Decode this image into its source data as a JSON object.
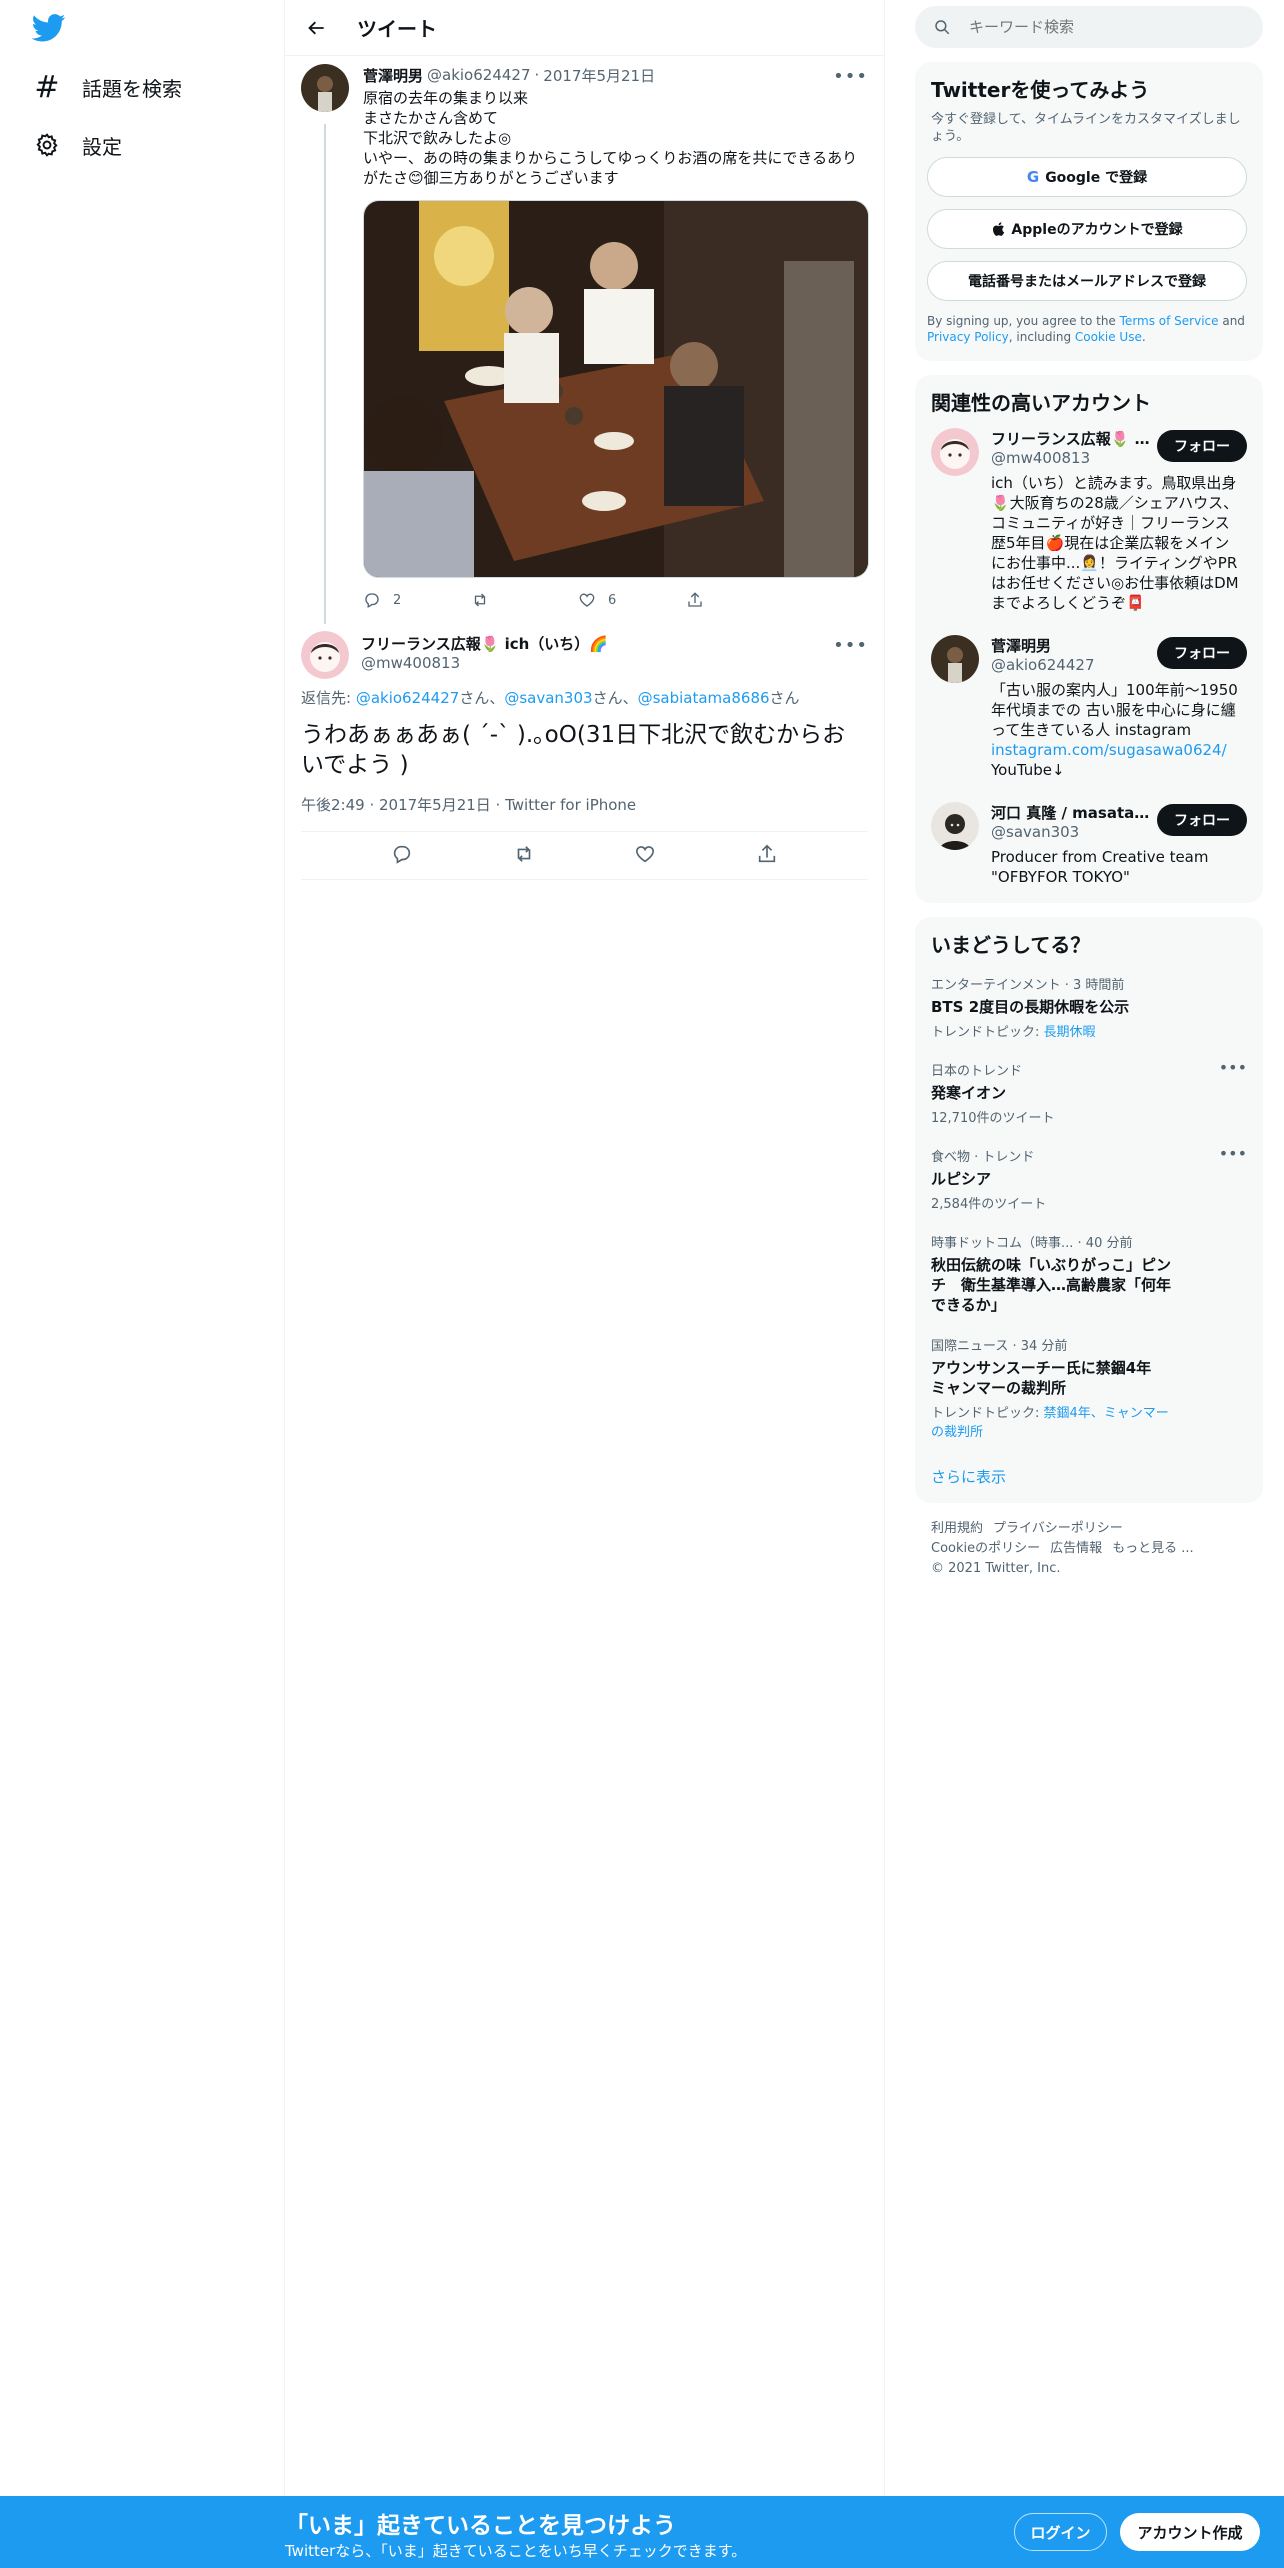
{
  "nav": {
    "explore_label": "話題を検索",
    "settings_label": "設定"
  },
  "header": {
    "title": "ツイート"
  },
  "tweet1": {
    "name": "菅澤明男",
    "handle": "@akio624427",
    "sep": "·",
    "date": "2017年5月21日",
    "text": "原宿の去年の集まり以来\nまさたかさん含めて\n下北沢で飲みしたよ◎\nいやー、あの時の集まりからこうしてゆっくりお酒の席を共にできるありがたさ😊御三方ありがとうございます",
    "reply_count": "2",
    "retweet_count": "",
    "like_count": "6"
  },
  "tweet2": {
    "name": "フリーランス広報🌷 ich（いち）🌈",
    "handle": "@mw400813",
    "reply_prefix": "返信先: ",
    "reply_users": [
      "@akio624427",
      "@savan303",
      "@sabiatama8686"
    ],
    "san": "さん",
    "comma": "、",
    "text": "うわあぁぁあぁ( ´-` ).｡oO(31日下北沢で飲むからおいでよう )",
    "timestamp": "午後2:49 · 2017年5月21日 · Twitter for iPhone"
  },
  "search": {
    "placeholder": "キーワード検索"
  },
  "signup": {
    "title": "Twitterを使ってみよう",
    "subtitle": "今すぐ登録して、タイムラインをカスタマイズしましょう。",
    "google_label": "Google で登録",
    "apple_label": "Appleのアカウントで登録",
    "phone_label": "電話番号またはメールアドレスで登録",
    "legal_prefix": "By signing up, you agree to the ",
    "terms": "Terms of Service",
    "and": " and ",
    "privacy": "Privacy Policy",
    "including": ", including ",
    "cookie": "Cookie Use",
    "period": "."
  },
  "who": {
    "title": "関連性の高いアカウント",
    "follow_label": "フォロー",
    "accounts": [
      {
        "name": "フリーランス広報🌷 ich（いち）🌈",
        "handle": "@mw400813",
        "bio": "ich（いち）と読みます。鳥取県出身🌷大阪育ちの28歳／シェアハウス、コミュニティが好き｜フリーランス歴5年目🍎現在は企業広報をメインにお仕事中...👩‍💼！ライティングやPRはお任せください◎お仕事依頼はDMまでよろしくどうぞ📮"
      },
      {
        "name": "菅澤明男",
        "handle": "@akio624427",
        "bio": "「古い服の案内人」100年前～1950年代頃までの 古い服を中心に身に纏って生きている人 instagram",
        "link": "instagram.com/sugasawa0624/",
        "bio2": "YouTube↓"
      },
      {
        "name": "河口 真隆 / masatak...",
        "handle": "@savan303",
        "bio": "Producer from Creative team \"OFBYFOR TOKYO\""
      }
    ]
  },
  "trends": {
    "title": "いまどうしてる？",
    "items": [
      {
        "cat": "エンターテインメント · 3 時間前",
        "title": "BTS 2度目の長期休暇を公示",
        "sub_prefix": "トレンドトピック: ",
        "sub_link": "長期休暇"
      },
      {
        "cat": "日本のトレンド",
        "title": "発寒イオン",
        "sub": "12,710件のツイート"
      },
      {
        "cat": "食べ物 · トレンド",
        "title": "ルピシア",
        "sub": "2,584件のツイート"
      },
      {
        "cat": "時事ドットコム（時事... · 40 分前",
        "title": "秋田伝統の味「いぶりがっこ」ピンチ　衛生基準導入…高齢農家「何年できるか」"
      },
      {
        "cat": "国際ニュース · 34 分前",
        "title": "アウンサンスーチー氏に禁錮4年 ミャンマーの裁判所",
        "sub_prefix": "トレンドトピック: ",
        "sub_link": "禁錮4年、ミャンマーの裁判所"
      }
    ],
    "show_more": "さらに表示"
  },
  "footer": {
    "links": [
      "利用規約",
      "プライバシーポリシー",
      "Cookieのポリシー",
      "広告情報",
      "もっと見る ..."
    ],
    "copyright": "© 2021 Twitter, Inc."
  },
  "bottom": {
    "title": "「いま」起きていることを見つけよう",
    "subtitle": "Twitterなら、「いま」起きていることをいち早くチェックできます。",
    "login": "ログイン",
    "signup": "アカウント作成"
  },
  "colors": {
    "accent": "#1d9bf0",
    "text": "#0f1419",
    "muted": "#536471"
  }
}
